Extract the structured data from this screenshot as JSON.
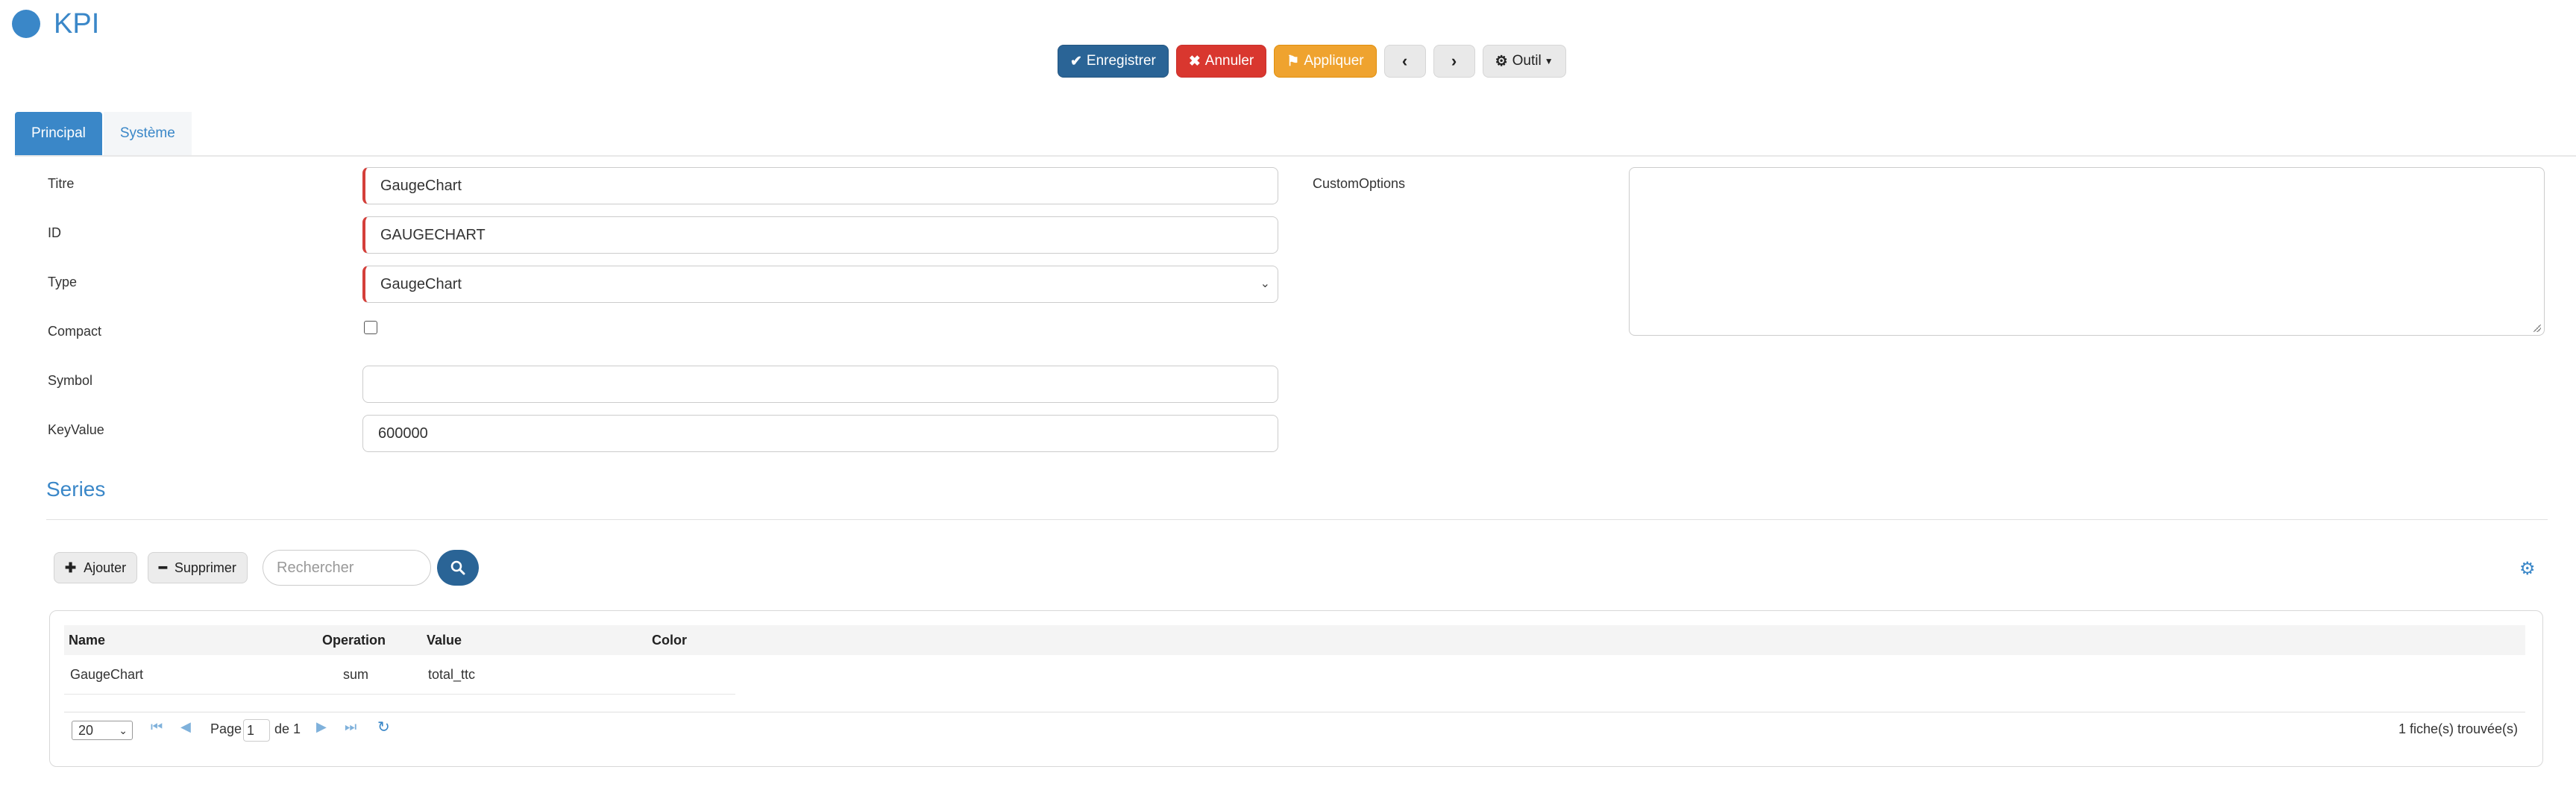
{
  "header": {
    "title": "KPI"
  },
  "toolbar": {
    "save_label": "Enregistrer",
    "cancel_label": "Annuler",
    "apply_label": "Appliquer",
    "tools_label": "Outil"
  },
  "tabs": [
    {
      "label": "Principal",
      "active": true
    },
    {
      "label": "Système",
      "active": false
    }
  ],
  "form": {
    "titre": {
      "label": "Titre",
      "value": "GaugeChart"
    },
    "id": {
      "label": "ID",
      "value": "GAUGECHART"
    },
    "type": {
      "label": "Type",
      "value": "GaugeChart"
    },
    "compact": {
      "label": "Compact",
      "checked": false
    },
    "symbol": {
      "label": "Symbol",
      "value": ""
    },
    "keyvalue": {
      "label": "KeyValue",
      "value": "600000"
    },
    "customoptions": {
      "label": "CustomOptions",
      "value": ""
    }
  },
  "series": {
    "title": "Series",
    "add_label": "Ajouter",
    "delete_label": "Supprimer",
    "search_placeholder": "Rechercher",
    "columns": [
      "Name",
      "Operation",
      "Value",
      "Color"
    ],
    "rows": [
      {
        "name": "GaugeChart",
        "operation": "sum",
        "value": "total_ttc",
        "color": ""
      }
    ],
    "pager": {
      "page_size": "20",
      "page_label": "Page",
      "page": "1",
      "of_label": "de 1",
      "count_text": "1 fiche(s) trouvée(s)"
    }
  },
  "colors": {
    "accent": "#3a87c8",
    "primary": "#2a6496",
    "danger": "#d9372f",
    "warning": "#efa32f",
    "required": "#d43f3a"
  },
  "icons": [
    "check-icon",
    "times-icon",
    "flag-icon",
    "chevron-left-icon",
    "chevron-right-icon",
    "gear-icon",
    "caret-down-icon",
    "plus-icon",
    "minus-icon",
    "search-icon",
    "first-page-icon",
    "prev-page-icon",
    "next-page-icon",
    "last-page-icon",
    "refresh-icon"
  ]
}
